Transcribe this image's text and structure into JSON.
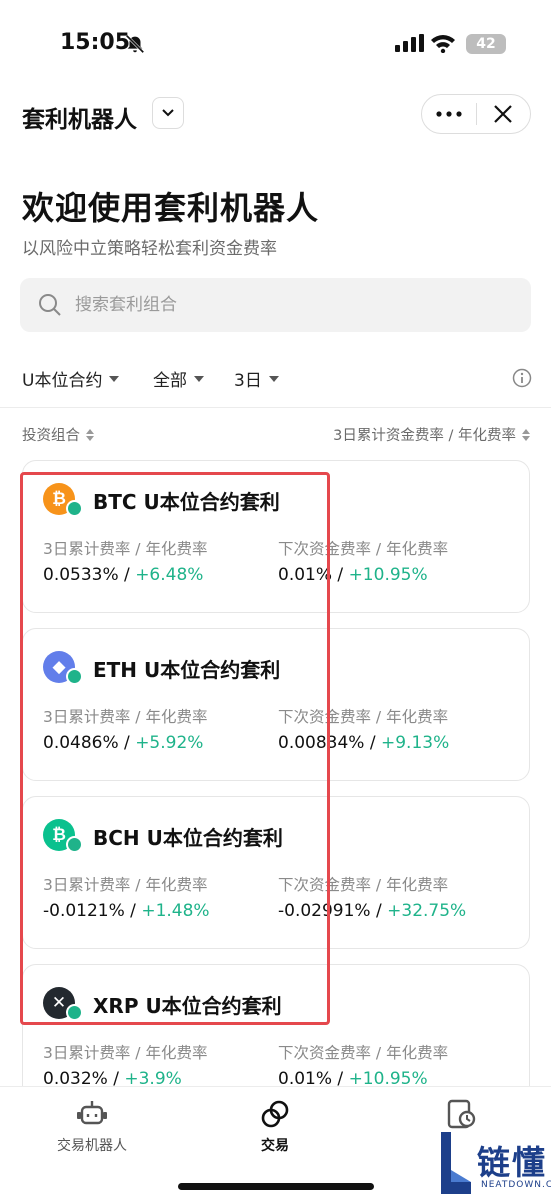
{
  "status": {
    "time": "15:05",
    "battery": "42"
  },
  "header": {
    "title": "套利机器人"
  },
  "welcome": {
    "title": "欢迎使用套利机器人",
    "subtitle": "以风险中立策略轻松套利资金费率"
  },
  "search": {
    "placeholder": "搜索套利组合"
  },
  "filters": [
    {
      "label": "U本位合约"
    },
    {
      "label": "全部"
    },
    {
      "label": "3日"
    }
  ],
  "columns": {
    "left": "投资组合",
    "right": "3日累计资金费率 / 年化费率"
  },
  "cards": [
    {
      "symbol": "BTC",
      "name": "BTC U本位合约套利",
      "coin_color": "#f7931a",
      "label1": "3日累计费率 / 年化费率",
      "rate1": "0.0533%",
      "sep": " / ",
      "annual1": "+6.48%",
      "label2": "下次资金费率 / 年化费率",
      "rate2": "0.01%",
      "annual2": "+10.95%"
    },
    {
      "symbol": "ETH",
      "name": "ETH U本位合约套利",
      "coin_color": "#627eea",
      "label1": "3日累计费率 / 年化费率",
      "rate1": "0.0486%",
      "sep": " / ",
      "annual1": "+5.92%",
      "label2": "下次资金费率 / 年化费率",
      "rate2": "0.00834%",
      "annual2": "+9.13%"
    },
    {
      "symbol": "BCH",
      "name": "BCH U本位合约套利",
      "coin_color": "#0ac18e",
      "label1": "3日累计费率 / 年化费率",
      "rate1": "-0.0121%",
      "sep": " / ",
      "annual1": "+1.48%",
      "label2": "下次资金费率 / 年化费率",
      "rate2": "-0.02991%",
      "annual2": "+32.75%"
    },
    {
      "symbol": "XRP",
      "name": "XRP U本位合约套利",
      "coin_color": "#23292f",
      "label1": "3日累计费率 / 年化费率",
      "rate1": "0.032%",
      "sep": " / ",
      "annual1": "+3.9%",
      "label2": "下次资金费率 / 年化费率",
      "rate2": "0.01%",
      "annual2": "+10.95%"
    }
  ],
  "tabs": [
    {
      "label": "交易机器人"
    },
    {
      "label": "交易"
    },
    {
      "label": ""
    }
  ],
  "watermark": {
    "brand": "链懂",
    "site": "NEATDOWN.COM"
  },
  "colors": {
    "positive": "#1fb38a",
    "highlight": "#e5484d"
  }
}
